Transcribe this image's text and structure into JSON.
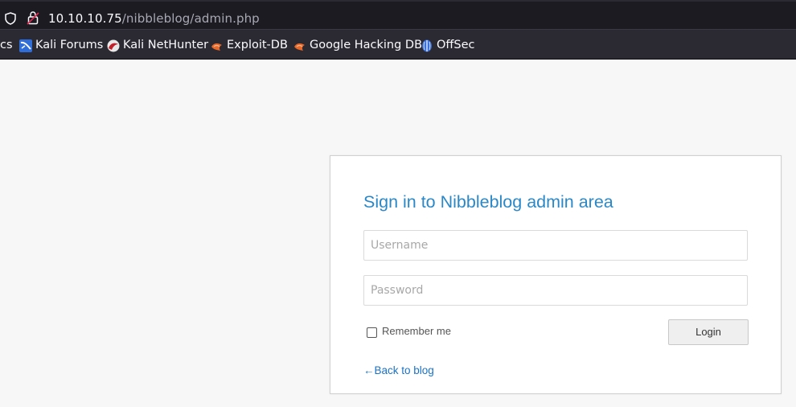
{
  "browser": {
    "url_host": "10.10.10.75",
    "url_path": "/nibbleblog/admin.php",
    "bookmarks": [
      {
        "label": "cs",
        "icon": "doc-icon"
      },
      {
        "label": "Kali Forums",
        "icon": "kali-forums-icon"
      },
      {
        "label": "Kali NetHunter",
        "icon": "kali-nethunter-icon"
      },
      {
        "label": "Exploit-DB",
        "icon": "exploitdb-icon"
      },
      {
        "label": "Google Hacking DB",
        "icon": "ghdb-icon"
      },
      {
        "label": "OffSec",
        "icon": "offsec-icon"
      }
    ]
  },
  "login": {
    "title": "Sign in to Nibbleblog admin area",
    "username_placeholder": "Username",
    "password_placeholder": "Password",
    "username_value": "",
    "password_value": "",
    "remember_label": "Remember me",
    "remember_checked": false,
    "login_label": "Login",
    "back_link": "←Back to blog"
  },
  "colors": {
    "title": "#2a88c8",
    "link": "#1a73c9",
    "chrome_bg": "#2b2a33",
    "page_bg": "#f7f7f7"
  }
}
